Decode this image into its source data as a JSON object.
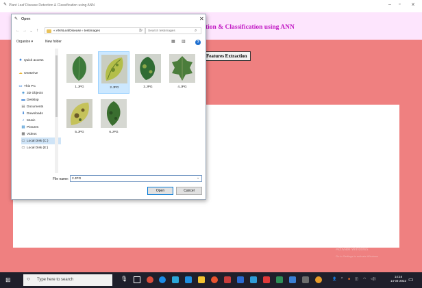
{
  "app": {
    "window_title": "Plant Leaf Disease Detection & Classification using ANN",
    "heading": "tion & Classification using ANN",
    "features_button": "Features Extraction",
    "watermark": "Activate Windows",
    "watermark_sub": "Go to Settings to activate Windows",
    "minimize": "–",
    "maximize": "▫",
    "close": "✕"
  },
  "dialog": {
    "title": "Open",
    "close": "✕",
    "address": "« ANNLeafDisease › testimages",
    "search_placeholder": "Search testimages",
    "organize": "Organize ▾",
    "new_folder": "New folder",
    "help": "?",
    "nav": [
      {
        "label": "Quick access",
        "icon": "★"
      },
      {
        "label": "OneDrive",
        "icon": "☁"
      },
      {
        "label": "This PC",
        "icon": "▭"
      },
      {
        "label": "3D Objects",
        "icon": "◈"
      },
      {
        "label": "Desktop",
        "icon": "▬"
      },
      {
        "label": "Documents",
        "icon": "▤"
      },
      {
        "label": "Downloads",
        "icon": "⬇"
      },
      {
        "label": "Music",
        "icon": "♪"
      },
      {
        "label": "Pictures",
        "icon": "▦"
      },
      {
        "label": "Videos",
        "icon": "▩"
      },
      {
        "label": "Local Disk (C:)",
        "icon": "▭"
      },
      {
        "label": "Local Disk (E:)",
        "icon": "▭"
      }
    ],
    "files": [
      {
        "name": "1.JPG"
      },
      {
        "name": "2.JPG"
      },
      {
        "name": "3.JPG"
      },
      {
        "name": "4.JPG"
      },
      {
        "name": "5.JPG"
      },
      {
        "name": "6.JPG"
      }
    ],
    "filename_label": "File name:",
    "filename_value": "2.JPG",
    "open_button": "Open",
    "cancel_button": "Cancel"
  },
  "taskbar": {
    "search_text": "Type here to search",
    "time": "14:16",
    "date": "14-04-2022"
  },
  "colors": {
    "header_bg": "#fde5fd",
    "heading_text": "#c118c4",
    "body_bg": "#ef8080"
  }
}
